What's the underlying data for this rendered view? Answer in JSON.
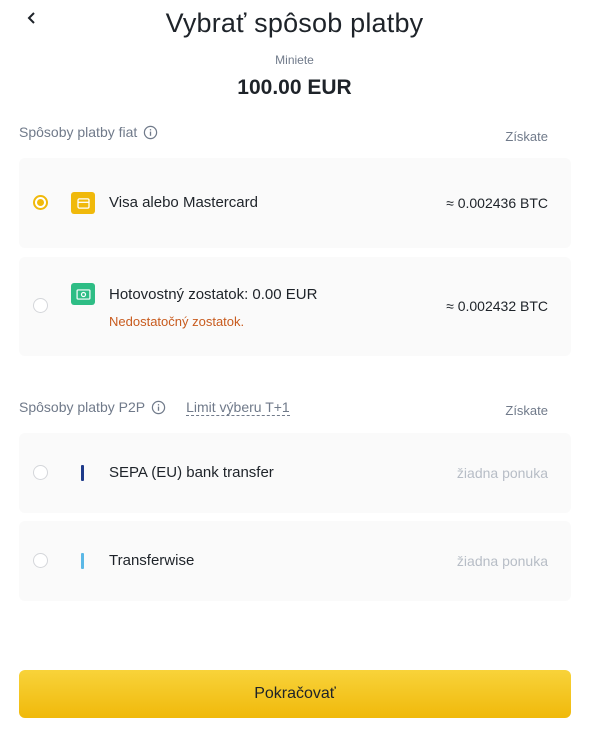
{
  "header": {
    "title": "Vybrať spôsob platby",
    "amount_label": "Miniete",
    "amount": "100.00 EUR"
  },
  "fiat_section": {
    "title": "Spôsoby platby fiat",
    "get_label": "Získate",
    "methods": [
      {
        "name": "Visa alebo Mastercard",
        "value": "≈ 0.002436 BTC",
        "selected": true,
        "icon": "card-icon",
        "icon_color": "#f0b90b"
      },
      {
        "name": "Hotovostný zostatok: 0.00 EUR",
        "warning": "Nedostatočný zostatok.",
        "value": "≈ 0.002432 BTC",
        "selected": false,
        "icon": "cash-icon",
        "icon_color": "#2ebd85"
      }
    ]
  },
  "p2p_section": {
    "title": "Spôsoby platby P2P",
    "limit_link": "Limit výberu T+1",
    "get_label": "Získate",
    "methods": [
      {
        "name": "SEPA (EU) bank transfer",
        "status": "žiadna ponuka",
        "selected": false,
        "bar_color": "#1e3a8a"
      },
      {
        "name": "Transferwise",
        "status": "žiadna ponuka",
        "selected": false,
        "bar_color": "#5bb8e6"
      }
    ]
  },
  "footer": {
    "continue_label": "Pokračovať"
  },
  "colors": {
    "accent": "#f0b90b",
    "warning": "#c85b1e",
    "muted": "#707a8a",
    "disabled": "#b7bdc6"
  }
}
